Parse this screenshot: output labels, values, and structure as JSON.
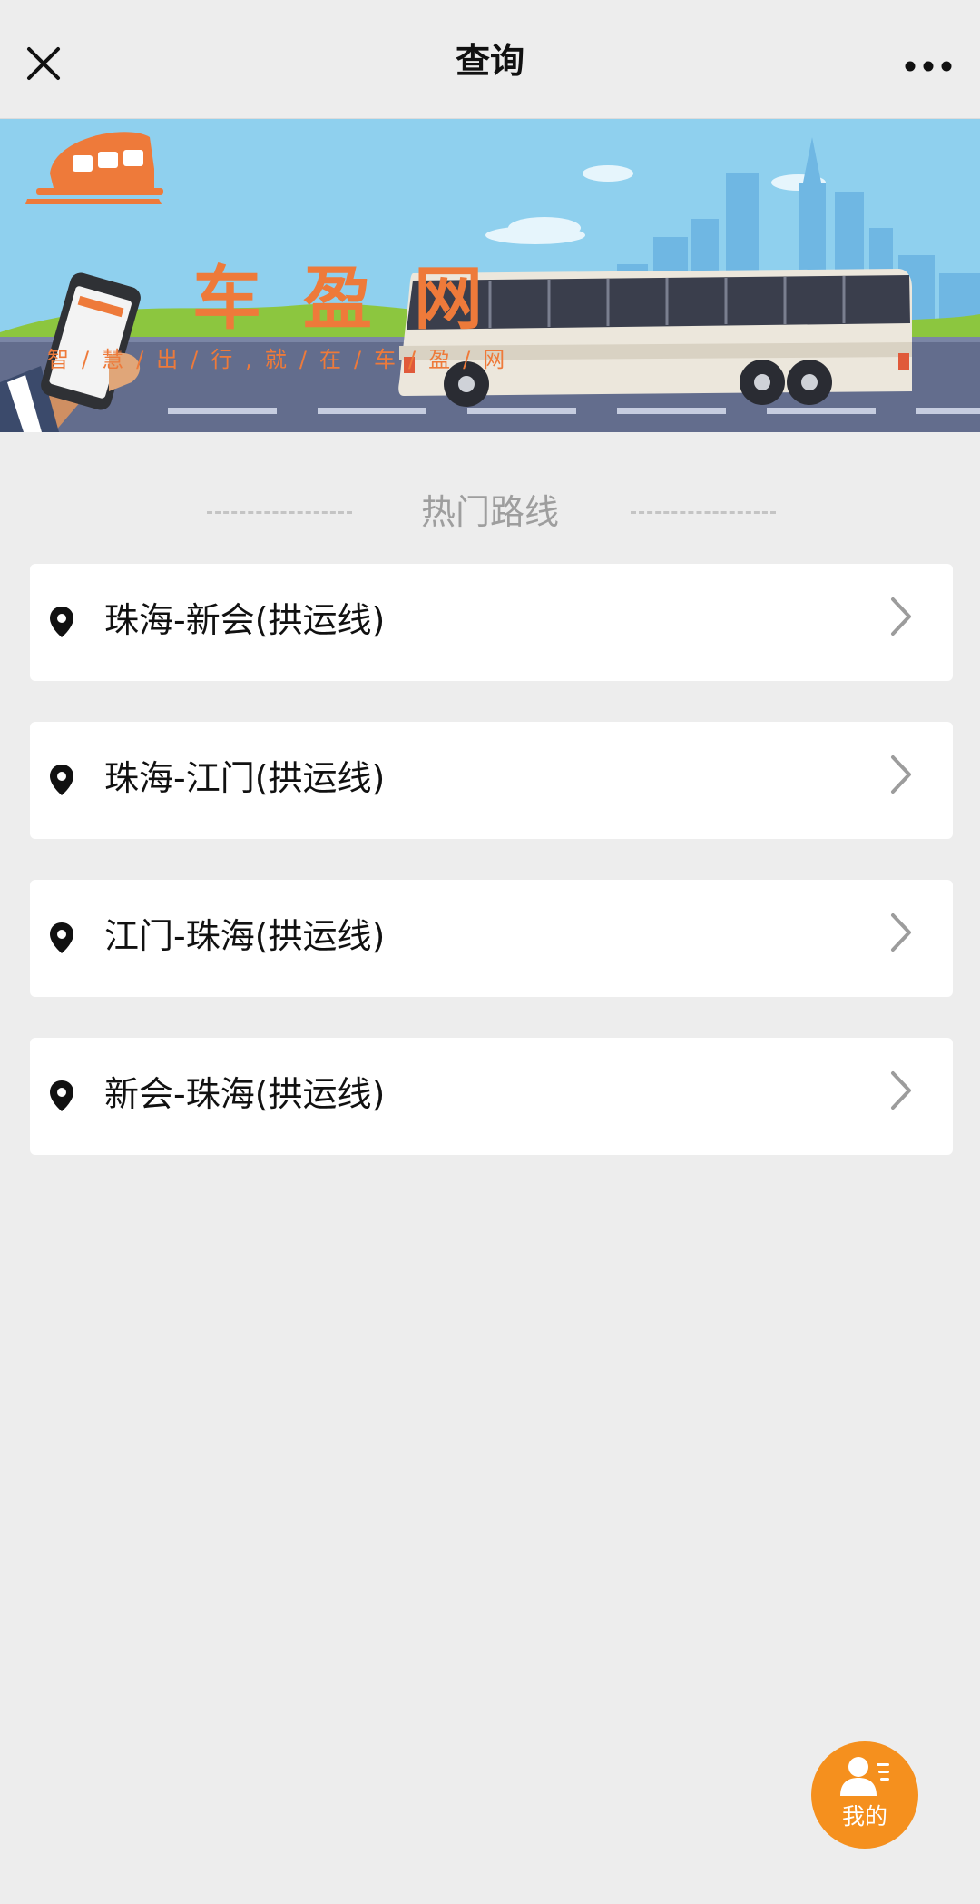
{
  "navbar": {
    "title": "查询",
    "close_icon": "close-icon",
    "more_icon": "more-icon"
  },
  "banner": {
    "brand_name": "车盈网",
    "slogan": "智/慧/出/行,就/在/车/盈/网",
    "colors": {
      "brand": "#ee7a3a",
      "sky": "#8fd0ee",
      "grass": "#8cc63f",
      "road": "#636d8d"
    }
  },
  "section": {
    "title": "热门路线"
  },
  "routes": [
    {
      "label": "珠海-新会(拱运线)",
      "icon": "location-pin-icon"
    },
    {
      "label": "珠海-江门(拱运线)",
      "icon": "location-pin-icon"
    },
    {
      "label": "江门-珠海(拱运线)",
      "icon": "location-pin-icon"
    },
    {
      "label": "新会-珠海(拱运线)",
      "icon": "location-pin-icon"
    }
  ],
  "fab": {
    "label": "我的",
    "icon": "user-profile-icon",
    "color": "#f5901e"
  }
}
